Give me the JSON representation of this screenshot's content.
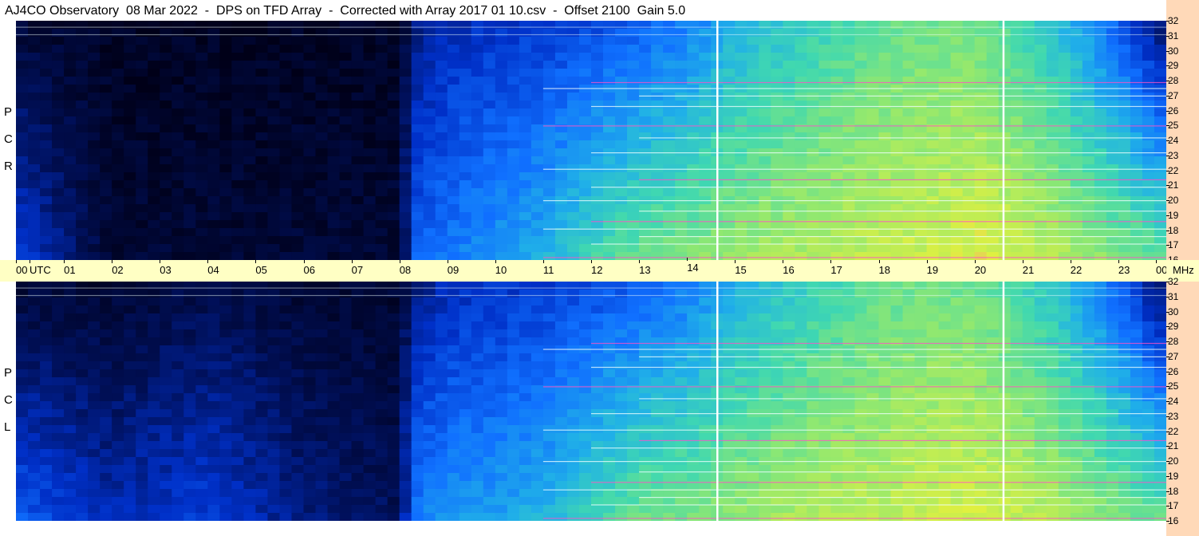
{
  "title": "AJ4CO Observatory  08 Mar 2022  -  DPS on TFD Array  -  Corrected with Array 2017 01 10.csv  -  Offset 2100  Gain 5.0",
  "colors": {
    "background": "#ffffff",
    "freq_axis_bg": "#ffd9b8",
    "time_axis_bg": "#ffffc4",
    "colormap": [
      "#000018",
      "#00105a",
      "#0030c8",
      "#1070ff",
      "#20b0e8",
      "#40d8b0",
      "#90e870",
      "#e0f040",
      "#ff40c0",
      "#ffffff"
    ]
  },
  "x_unit_label": "UTC",
  "y_unit_label": "MHz",
  "polarizations": {
    "top": [
      "P",
      "C",
      "R"
    ],
    "bottom": [
      "P",
      "C",
      "L"
    ]
  },
  "chart_data": [
    {
      "type": "heatmap",
      "panel": "RCP",
      "xlabel": "UTC",
      "ylabel": "MHz",
      "xlim": [
        0,
        24
      ],
      "ylim": [
        16,
        32
      ],
      "x_ticks": [
        "00",
        "01",
        "02",
        "03",
        "04",
        "05",
        "06",
        "07",
        "08",
        "09",
        "10",
        "11",
        "12",
        "13",
        "14",
        "15",
        "16",
        "17",
        "18",
        "19",
        "20",
        "21",
        "22",
        "23",
        "00"
      ],
      "y_ticks": [
        "32",
        "31",
        "30",
        "29",
        "28",
        "27",
        "26",
        "25",
        "24",
        "23",
        "22",
        "21",
        "20",
        "19",
        "18",
        "17",
        "16"
      ],
      "hours": [
        0,
        2,
        4,
        6,
        8,
        8.3,
        9,
        10,
        11,
        12,
        13,
        14,
        15,
        16,
        17,
        18,
        19,
        20,
        21,
        22,
        23,
        24
      ],
      "intensity_low_freq": [
        0.25,
        0.05,
        0.05,
        0.05,
        0.05,
        0.3,
        0.35,
        0.4,
        0.45,
        0.55,
        0.62,
        0.65,
        0.68,
        0.7,
        0.72,
        0.74,
        0.75,
        0.78,
        0.75,
        0.7,
        0.65,
        0.6
      ],
      "intensity_high_freq": [
        0.05,
        0.02,
        0.02,
        0.02,
        0.02,
        0.15,
        0.2,
        0.22,
        0.24,
        0.26,
        0.3,
        0.35,
        0.45,
        0.5,
        0.55,
        0.6,
        0.62,
        0.62,
        0.55,
        0.45,
        0.3,
        0.1
      ],
      "interference_lines_mhz": [
        16.2,
        17.1,
        17.6,
        18.1,
        18.6,
        19.3,
        20.0,
        20.9,
        21.4,
        22.1,
        23.2,
        24.2,
        25.0,
        26.3,
        27.0,
        27.5,
        27.9,
        31.1,
        31.6
      ],
      "vertical_lines_utc": [
        14.63,
        20.6
      ]
    },
    {
      "type": "heatmap",
      "panel": "LCP",
      "xlabel": "UTC",
      "ylabel": "MHz",
      "xlim": [
        0,
        24
      ],
      "ylim": [
        16,
        32
      ],
      "x_ticks": [
        "00",
        "01",
        "02",
        "03",
        "04",
        "05",
        "06",
        "07",
        "08",
        "09",
        "10",
        "11",
        "12",
        "13",
        "14",
        "15",
        "16",
        "17",
        "18",
        "19",
        "20",
        "21",
        "22",
        "23",
        "00"
      ],
      "y_ticks": [
        "32",
        "31",
        "30",
        "29",
        "28",
        "27",
        "26",
        "25",
        "24",
        "23",
        "22",
        "21",
        "20",
        "19",
        "18",
        "17",
        "16"
      ],
      "hours": [
        0,
        2,
        4,
        6,
        8,
        8.3,
        9,
        10,
        11,
        12,
        13,
        14,
        15,
        16,
        17,
        18,
        19,
        20,
        21,
        22,
        23,
        24
      ],
      "intensity_low_freq": [
        0.3,
        0.2,
        0.25,
        0.15,
        0.1,
        0.35,
        0.4,
        0.42,
        0.46,
        0.55,
        0.62,
        0.64,
        0.67,
        0.7,
        0.72,
        0.73,
        0.75,
        0.76,
        0.74,
        0.7,
        0.65,
        0.6
      ],
      "intensity_high_freq": [
        0.05,
        0.04,
        0.08,
        0.05,
        0.04,
        0.15,
        0.2,
        0.22,
        0.24,
        0.26,
        0.3,
        0.35,
        0.45,
        0.5,
        0.55,
        0.6,
        0.62,
        0.62,
        0.55,
        0.45,
        0.3,
        0.1
      ],
      "interference_lines_mhz": [
        16.2,
        17.1,
        17.6,
        18.1,
        18.6,
        19.3,
        20.0,
        20.9,
        21.4,
        22.1,
        23.2,
        24.2,
        25.0,
        26.3,
        27.0,
        27.5,
        27.9,
        31.1,
        31.6
      ],
      "vertical_lines_utc": [
        14.63,
        20.6
      ]
    }
  ]
}
